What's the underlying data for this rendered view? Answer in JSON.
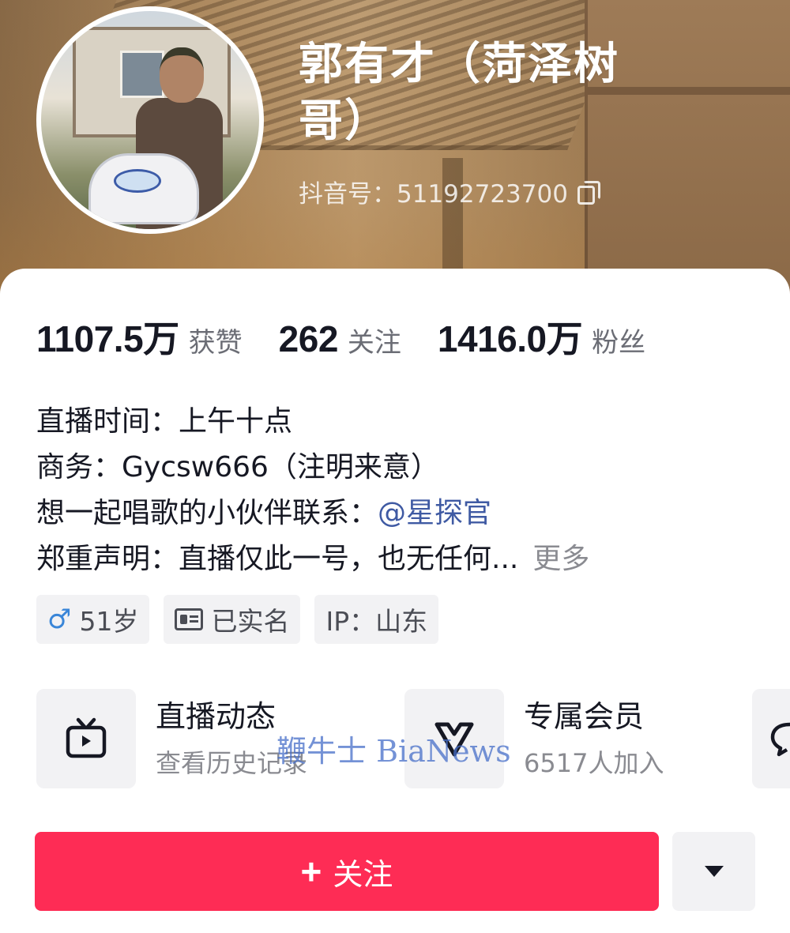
{
  "profile": {
    "name": "郭有才（菏泽树哥）",
    "name_line1": "郭有才（菏泽树",
    "name_line2": "哥）",
    "douyin_id": "抖音号：51192723700"
  },
  "stats": [
    {
      "value": "1107.5万",
      "label": "获赞"
    },
    {
      "value": "262",
      "label": "关注"
    },
    {
      "value": "1416.0万",
      "label": "粉丝"
    }
  ],
  "bio": {
    "line1": "直播时间：上午十点",
    "line2": "商务：Gycsw666（注明来意）",
    "line3_prefix": "想一起唱歌的小伙伴联系：",
    "line3_mention": "@星探官",
    "line4": "郑重声明：直播仅此一号，也无任何...",
    "more": "更多"
  },
  "tags": {
    "gender_symbol": "♂",
    "age": "51岁",
    "verified": "已实名",
    "ip": "IP：山东"
  },
  "features": [
    {
      "title": "直播动态",
      "subtitle": "查看历史记录",
      "icon": "tv-icon"
    },
    {
      "title": "专属会员",
      "subtitle": "6517人加入",
      "icon": "heart-badge-icon"
    },
    {
      "icon": "chat-bubble-icon"
    }
  ],
  "watermark": "鞭牛士 BiaNews",
  "actions": {
    "follow_label": "关注",
    "follow_plus": "+"
  },
  "colors": {
    "accent": "#fe2c55",
    "mention": "#3f5aa3",
    "tag_bg": "#f2f2f4"
  }
}
